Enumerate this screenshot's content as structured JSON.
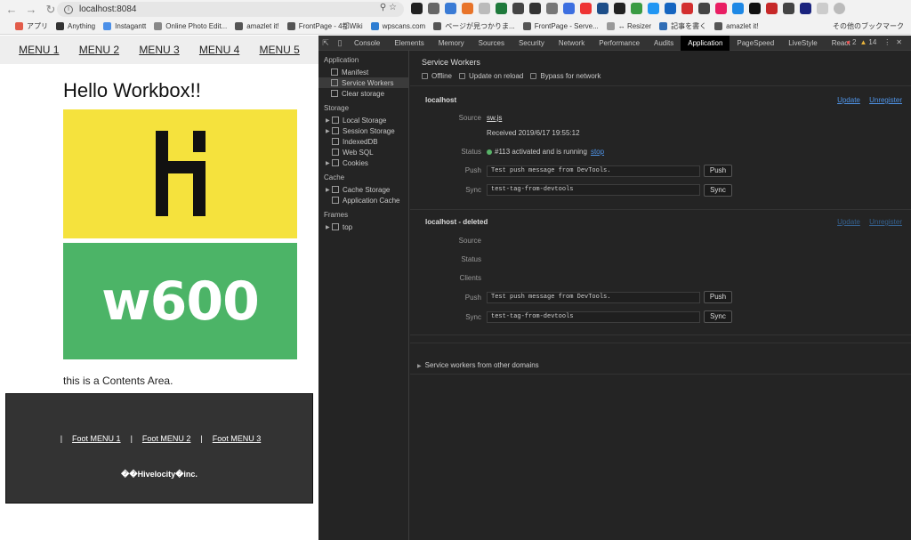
{
  "browser": {
    "url": "localhost:8084",
    "bookmarks": [
      {
        "label": "アプリ",
        "color": "#e25c4a"
      },
      {
        "label": "Anything",
        "color": "#333333"
      },
      {
        "label": "Instagantt",
        "color": "#4a8fe8"
      },
      {
        "label": "Online Photo Edit...",
        "color": "#888888"
      },
      {
        "label": "amazlet it!",
        "color": "#555555"
      },
      {
        "label": "FrontPage - 4都Wiki",
        "color": "#555555"
      },
      {
        "label": "wpscans.com",
        "color": "#2d7dd2"
      },
      {
        "label": "ページが見つかりま...",
        "color": "#555555"
      },
      {
        "label": "FrontPage - Serve...",
        "color": "#555555"
      },
      {
        "label": "↔ Resizer",
        "color": "#999999"
      },
      {
        "label": "記事を書く",
        "color": "#2f6db5"
      },
      {
        "label": "amazlet it!",
        "color": "#555555"
      }
    ],
    "other_bookmarks": "その他のブックマーク"
  },
  "page": {
    "menu": [
      "MENU 1",
      "MENU 2",
      "MENU 3",
      "MENU 4",
      "MENU 5"
    ],
    "heading": "Hello Workbox!!",
    "image_text": "w600",
    "contents": "this is a Contents Area.",
    "foot_menu": [
      "Foot MENU 1",
      "Foot MENU 2",
      "Foot MENU 3"
    ],
    "foot_separator": "|",
    "copyright": "��Hivelocity�inc.",
    "colors": {
      "yellow": "#f5e23d",
      "green": "#4cb467",
      "footer": "#333333"
    }
  },
  "devtools": {
    "tabs": [
      "Console",
      "Elements",
      "Memory",
      "Sources",
      "Security",
      "Network",
      "Performance",
      "Audits",
      "Application",
      "PageSpeed",
      "LiveStyle",
      "React"
    ],
    "active_tab": "Application",
    "errors": "2",
    "warnings": "14",
    "sidebar": {
      "application_head": "Application",
      "application_items": [
        "Manifest",
        "Service Workers",
        "Clear storage"
      ],
      "storage_head": "Storage",
      "storage_items": [
        "Local Storage",
        "Session Storage",
        "IndexedDB",
        "Web SQL",
        "Cookies"
      ],
      "cache_head": "Cache",
      "cache_items": [
        "Cache Storage",
        "Application Cache"
      ],
      "frames_head": "Frames",
      "frames_items": [
        "top"
      ]
    },
    "sw": {
      "title": "Service Workers",
      "options": [
        "Offline",
        "Update on reload",
        "Bypass for network"
      ],
      "update": "Update",
      "unregister": "Unregister",
      "labels": {
        "source": "Source",
        "status": "Status",
        "clients": "Clients",
        "push": "Push",
        "sync": "Sync"
      },
      "active": {
        "name": "localhost",
        "source": "sw.js",
        "received": "Received 2019/6/17 19:55:12",
        "status": "#113 activated and is running",
        "stop": "stop",
        "push_value": "Test push message from DevTools.",
        "sync_value": "test-tag-from-devtools",
        "push_button": "Push",
        "sync_button": "Sync"
      },
      "deleted": {
        "name": "localhost - deleted",
        "push_value": "Test push message from DevTools.",
        "sync_value": "test-tag-from-devtools",
        "push_button": "Push",
        "sync_button": "Sync"
      },
      "other_domains": "Service workers from other domains"
    }
  }
}
